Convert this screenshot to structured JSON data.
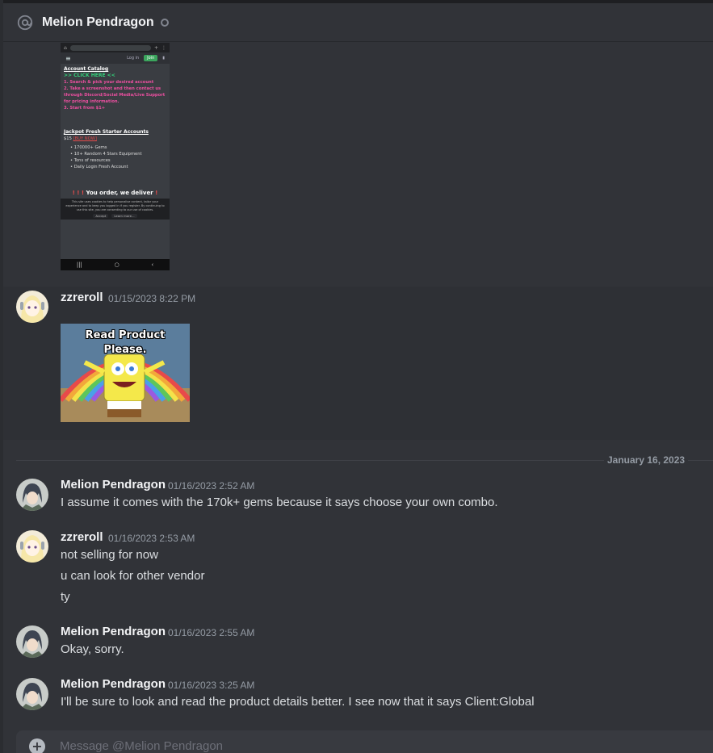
{
  "header": {
    "title": "Melion Pendragon",
    "at_icon": "at-icon",
    "status": "offline"
  },
  "attachment1": {
    "nav_login": "Log in",
    "nav_join": "Join",
    "heading": "Account Catalog",
    "click_here": ">> CLICK HERE <<",
    "steps": [
      "1. Search & pick your desired account",
      "2. Take a screenshot and then contact us through Discord/Social Media/Live Support for pricing information.",
      "3. Start from $1+"
    ],
    "jackpot_title": "Jackpot Fresh Starter Accounts",
    "jackpot_price": "$15",
    "buy_now": "[BUY NOW]",
    "features": [
      "170000+ Gems",
      "10+ Random 4 Stars Equipment",
      "Tons of resources",
      "Daily Login Fresh Account"
    ],
    "deliver": "You order, we deliver",
    "cookie_text": "This site uses cookies to help personalise content, tailor your experience and to keep you logged in if you register. By continuing to use this site, you are consenting to our use of cookies.",
    "accept": "Accept",
    "learn_more": "Learn more..."
  },
  "messages": [
    {
      "author": "zzreroll",
      "timestamp": "01/15/2023 8:22 PM",
      "meme_text": "Read Product Please."
    },
    {
      "author": "Melion Pendragon",
      "timestamp": "01/16/2023 2:52 AM",
      "lines": [
        "I assume it comes with the 170k+ gems because it says choose your own combo."
      ]
    },
    {
      "author": "zzreroll",
      "timestamp": "01/16/2023 2:53 AM",
      "lines": [
        "not selling for now",
        "u can look for other vendor",
        "ty"
      ]
    },
    {
      "author": "Melion Pendragon",
      "timestamp": "01/16/2023 2:55 AM",
      "lines": [
        "Okay, sorry."
      ]
    },
    {
      "author": "Melion Pendragon",
      "timestamp": "01/16/2023 3:25 AM",
      "lines": [
        "I'll be sure to look and read the product details better. I see now that it says Client:Global"
      ]
    }
  ],
  "date_divider": "January 16, 2023",
  "composer": {
    "placeholder": "Message @Melion Pendragon"
  },
  "colors": {
    "background": "#313338",
    "header_text": "#f2f3f5",
    "timestamp": "#949ba4",
    "link_green": "#33d17a",
    "pink": "#ec4fa0"
  }
}
